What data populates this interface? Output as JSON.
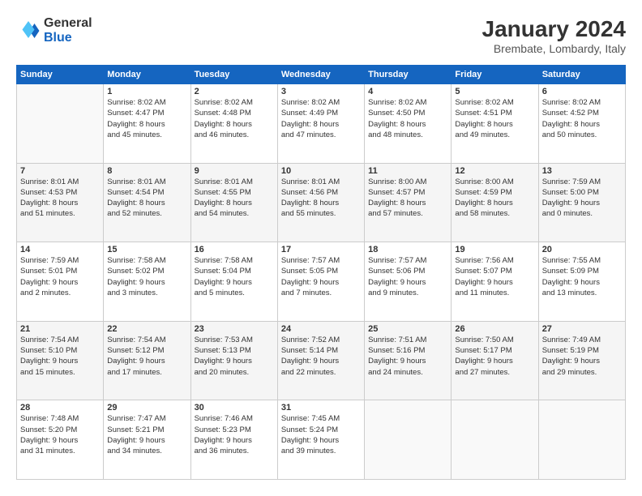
{
  "header": {
    "logo_general": "General",
    "logo_blue": "Blue",
    "title": "January 2024",
    "subtitle": "Brembate, Lombardy, Italy"
  },
  "calendar": {
    "weekdays": [
      "Sunday",
      "Monday",
      "Tuesday",
      "Wednesday",
      "Thursday",
      "Friday",
      "Saturday"
    ],
    "weeks": [
      [
        {
          "day": "",
          "info": ""
        },
        {
          "day": "1",
          "info": "Sunrise: 8:02 AM\nSunset: 4:47 PM\nDaylight: 8 hours\nand 45 minutes."
        },
        {
          "day": "2",
          "info": "Sunrise: 8:02 AM\nSunset: 4:48 PM\nDaylight: 8 hours\nand 46 minutes."
        },
        {
          "day": "3",
          "info": "Sunrise: 8:02 AM\nSunset: 4:49 PM\nDaylight: 8 hours\nand 47 minutes."
        },
        {
          "day": "4",
          "info": "Sunrise: 8:02 AM\nSunset: 4:50 PM\nDaylight: 8 hours\nand 48 minutes."
        },
        {
          "day": "5",
          "info": "Sunrise: 8:02 AM\nSunset: 4:51 PM\nDaylight: 8 hours\nand 49 minutes."
        },
        {
          "day": "6",
          "info": "Sunrise: 8:02 AM\nSunset: 4:52 PM\nDaylight: 8 hours\nand 50 minutes."
        }
      ],
      [
        {
          "day": "7",
          "info": "Sunrise: 8:01 AM\nSunset: 4:53 PM\nDaylight: 8 hours\nand 51 minutes."
        },
        {
          "day": "8",
          "info": "Sunrise: 8:01 AM\nSunset: 4:54 PM\nDaylight: 8 hours\nand 52 minutes."
        },
        {
          "day": "9",
          "info": "Sunrise: 8:01 AM\nSunset: 4:55 PM\nDaylight: 8 hours\nand 54 minutes."
        },
        {
          "day": "10",
          "info": "Sunrise: 8:01 AM\nSunset: 4:56 PM\nDaylight: 8 hours\nand 55 minutes."
        },
        {
          "day": "11",
          "info": "Sunrise: 8:00 AM\nSunset: 4:57 PM\nDaylight: 8 hours\nand 57 minutes."
        },
        {
          "day": "12",
          "info": "Sunrise: 8:00 AM\nSunset: 4:59 PM\nDaylight: 8 hours\nand 58 minutes."
        },
        {
          "day": "13",
          "info": "Sunrise: 7:59 AM\nSunset: 5:00 PM\nDaylight: 9 hours\nand 0 minutes."
        }
      ],
      [
        {
          "day": "14",
          "info": "Sunrise: 7:59 AM\nSunset: 5:01 PM\nDaylight: 9 hours\nand 2 minutes."
        },
        {
          "day": "15",
          "info": "Sunrise: 7:58 AM\nSunset: 5:02 PM\nDaylight: 9 hours\nand 3 minutes."
        },
        {
          "day": "16",
          "info": "Sunrise: 7:58 AM\nSunset: 5:04 PM\nDaylight: 9 hours\nand 5 minutes."
        },
        {
          "day": "17",
          "info": "Sunrise: 7:57 AM\nSunset: 5:05 PM\nDaylight: 9 hours\nand 7 minutes."
        },
        {
          "day": "18",
          "info": "Sunrise: 7:57 AM\nSunset: 5:06 PM\nDaylight: 9 hours\nand 9 minutes."
        },
        {
          "day": "19",
          "info": "Sunrise: 7:56 AM\nSunset: 5:07 PM\nDaylight: 9 hours\nand 11 minutes."
        },
        {
          "day": "20",
          "info": "Sunrise: 7:55 AM\nSunset: 5:09 PM\nDaylight: 9 hours\nand 13 minutes."
        }
      ],
      [
        {
          "day": "21",
          "info": "Sunrise: 7:54 AM\nSunset: 5:10 PM\nDaylight: 9 hours\nand 15 minutes."
        },
        {
          "day": "22",
          "info": "Sunrise: 7:54 AM\nSunset: 5:12 PM\nDaylight: 9 hours\nand 17 minutes."
        },
        {
          "day": "23",
          "info": "Sunrise: 7:53 AM\nSunset: 5:13 PM\nDaylight: 9 hours\nand 20 minutes."
        },
        {
          "day": "24",
          "info": "Sunrise: 7:52 AM\nSunset: 5:14 PM\nDaylight: 9 hours\nand 22 minutes."
        },
        {
          "day": "25",
          "info": "Sunrise: 7:51 AM\nSunset: 5:16 PM\nDaylight: 9 hours\nand 24 minutes."
        },
        {
          "day": "26",
          "info": "Sunrise: 7:50 AM\nSunset: 5:17 PM\nDaylight: 9 hours\nand 27 minutes."
        },
        {
          "day": "27",
          "info": "Sunrise: 7:49 AM\nSunset: 5:19 PM\nDaylight: 9 hours\nand 29 minutes."
        }
      ],
      [
        {
          "day": "28",
          "info": "Sunrise: 7:48 AM\nSunset: 5:20 PM\nDaylight: 9 hours\nand 31 minutes."
        },
        {
          "day": "29",
          "info": "Sunrise: 7:47 AM\nSunset: 5:21 PM\nDaylight: 9 hours\nand 34 minutes."
        },
        {
          "day": "30",
          "info": "Sunrise: 7:46 AM\nSunset: 5:23 PM\nDaylight: 9 hours\nand 36 minutes."
        },
        {
          "day": "31",
          "info": "Sunrise: 7:45 AM\nSunset: 5:24 PM\nDaylight: 9 hours\nand 39 minutes."
        },
        {
          "day": "",
          "info": ""
        },
        {
          "day": "",
          "info": ""
        },
        {
          "day": "",
          "info": ""
        }
      ]
    ]
  }
}
